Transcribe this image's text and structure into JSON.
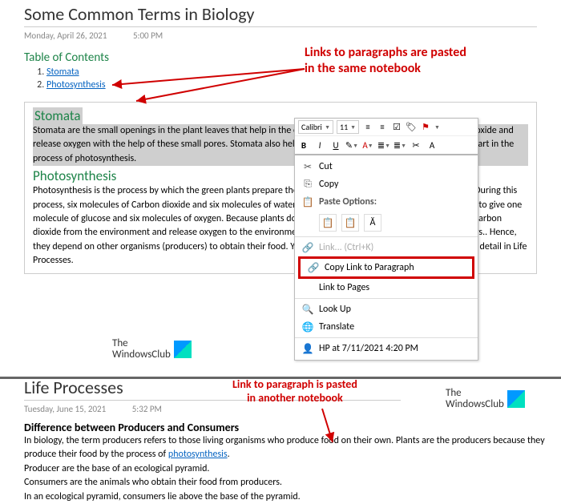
{
  "page1": {
    "title": "Some Common Terms in Biology",
    "date": "Monday, April 26, 2021",
    "time": "5:00 PM",
    "toc_heading": "Table of Contents",
    "toc": [
      "Stomata",
      "Photosynthesis"
    ],
    "annot": "Links to paragraphs are pasted\nin the same notebook",
    "stomata_h": "Stomata",
    "stomata_p": "Stomata are the small openings in the plant leaves that help in the exchange of gases. The plants take in carbon dioxide and release oxygen with the help of these small pores. Stomata also help in transpiration process. Stomata also takes part in the process of photosynthesis.",
    "photo_h": "Photosynthesis",
    "photo_p": "Photosynthesis is the process by which the green plants prepare their food in the presence of sunlight and water. During this process, six molecules of Carbon dioxide and six molecules of water combine in presence of water and chlorophyll to give one molecule of glucose and six molecules of oxygen. Because plants do the process of photosynthesis, plants absorb carbon dioxide from the environment and release oxygen to the environment. Photosynthesis does not occur in consumers.. Hence, they depend on other organisms (producers) to obtain their food. You can read about producers and consumers in detail in Life Processes."
  },
  "toolbar": {
    "font": "Calibri",
    "size": "11"
  },
  "ctx": {
    "cut": "Cut",
    "copy": "Copy",
    "paste_opts": "Paste Options:",
    "link": "Link...   (Ctrl+K)",
    "copy_link_para": "Copy Link to Paragraph",
    "link_pages": "Link to Pages",
    "lookup": "Look Up",
    "translate": "Translate",
    "hp": "HP at 7/11/2021 4:20 PM"
  },
  "logo": {
    "l1": "The",
    "l2": "WindowsClub"
  },
  "page2": {
    "title": "Life Processes",
    "date": "Tuesday, June 15, 2021",
    "time": "5:32 PM",
    "annot": "Link to paragraph is pasted\nin another notebook",
    "h": "Difference between Producers and Consumers",
    "p1a": "In biology, the term producers refers to those living organisms who produce food on their own. Plants are the producers because they produce their food by the process of ",
    "p1link": "photosynthesis",
    "p1b": ".",
    "p2": "Producer are the base of an ecological pyramid.",
    "p3": "Consumers are the animals who obtain their food from producers.",
    "p4": "In an ecological pyramid, consumers lie above the base of the pyramid."
  }
}
